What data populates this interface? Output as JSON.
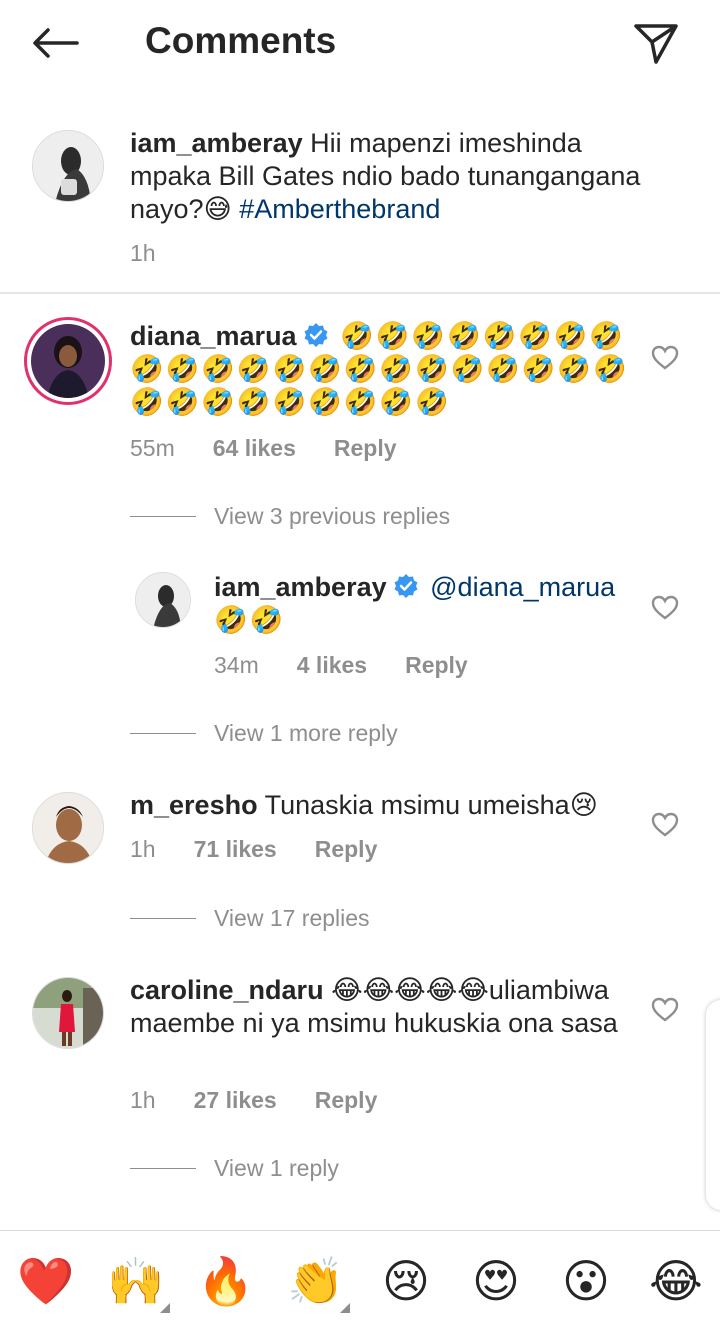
{
  "header": {
    "title": "Comments"
  },
  "caption": {
    "username": "iam_amberay",
    "text": "Hii mapenzi imeshinda mpaka Bill Gates ndio bado tunangangana nayo?😅",
    "hashtag": "#Amberthebrand",
    "time": "1h"
  },
  "comments": [
    {
      "username": "diana_marua",
      "verified": true,
      "text": "🤣🤣🤣🤣🤣🤣🤣🤣🤣🤣🤣🤣🤣🤣🤣🤣🤣🤣🤣🤣🤣🤣🤣🤣🤣🤣🤣🤣🤣🤣🤣",
      "time": "55m",
      "likes": "64 likes",
      "reply": "Reply",
      "view_replies": "View 3 previous replies"
    },
    {
      "username": "iam_amberay",
      "verified": true,
      "mention": "@diana_marua",
      "text": "🤣🤣",
      "time": "34m",
      "likes": "4 likes",
      "reply": "Reply",
      "view_replies": "View 1 more reply"
    },
    {
      "username": "m_eresho",
      "text": "Tunaskia msimu umeisha😢",
      "time": "1h",
      "likes": "71 likes",
      "reply": "Reply",
      "view_replies": "View 17 replies"
    },
    {
      "username": "caroline_ndaru",
      "text": "😂😂😂😂😂uliambiwa maembe ni ya msimu hukuskia ona sasa",
      "time": "1h",
      "likes": "27 likes",
      "reply": "Reply",
      "view_replies": "View 1 reply"
    }
  ],
  "reactions": [
    "❤️",
    "🙌",
    "🔥",
    "👏",
    "😢",
    "😍",
    "😮",
    "😂"
  ],
  "icons": {
    "back": "arrow-left-icon",
    "send": "paper-plane-icon",
    "like": "heart-outline-icon",
    "verified": "verified-badge-icon"
  },
  "colors": {
    "link": "#00376b",
    "verified": "#3897f0",
    "meta": "#8e8e8e",
    "story_ring": "#e1306c"
  }
}
